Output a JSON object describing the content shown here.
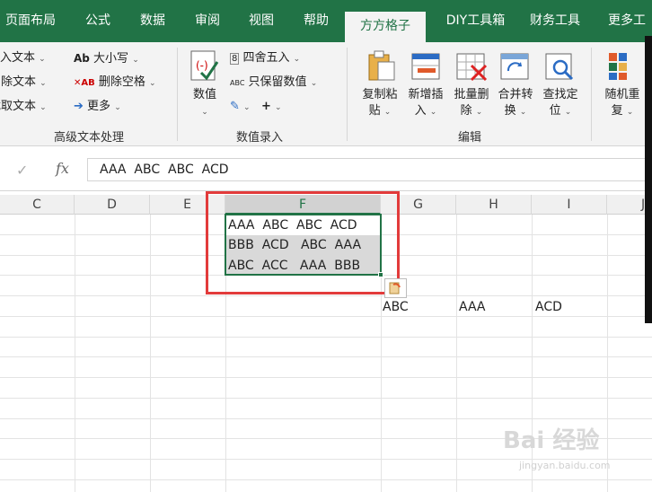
{
  "tabs": [
    "页面布局",
    "公式",
    "数据",
    "审阅",
    "视图",
    "帮助",
    "方方格子",
    "DIY工具箱",
    "财务工具",
    "更多工"
  ],
  "active_tab": "方方格子",
  "ribbon": {
    "text_group": {
      "item1": "插入文本",
      "item1_visible": "入文本",
      "item2_visible": "删除文本",
      "item3_visible": "截取文本",
      "case": "大小写",
      "remove_spaces": "删除空格",
      "more": "更多",
      "label": "高级文本处理"
    },
    "number_group": {
      "value_btn": "数值",
      "round": "四舍五入",
      "keep_values": "只保留数值",
      "label": "数值录入"
    },
    "edit_group": {
      "copy_paste_1": "复制粘",
      "copy_paste_2": "贴",
      "new_insert_1": "新增插",
      "new_insert_2": "入",
      "batch_delete_1": "批量删",
      "batch_delete_2": "除",
      "merge_convert_1": "合并转",
      "merge_convert_2": "换",
      "find_locate_1": "查找定",
      "find_locate_2": "位",
      "label": "编辑"
    },
    "random_group": {
      "random_1": "随机重",
      "random_2": "复"
    }
  },
  "formula_bar": {
    "fx": "fx",
    "content": "AAA  ABC  ABC  ACD"
  },
  "columns": [
    "C",
    "D",
    "E",
    "F",
    "G",
    "H",
    "I",
    "J"
  ],
  "selected_column": "F",
  "cells": {
    "F1": "AAA  ABC  ABC  ACD",
    "F2": "BBB  ACD   ABC  AAA",
    "F3": "ABC  ACC   AAA  BBB",
    "G5": "ABC",
    "H5": "AAA",
    "I5": "ACD"
  },
  "watermark": {
    "brand": "Bai 经验",
    "url": "jingyan.baidu.com"
  },
  "colors": {
    "accent": "#217346",
    "highlight": "#e23b3b"
  }
}
